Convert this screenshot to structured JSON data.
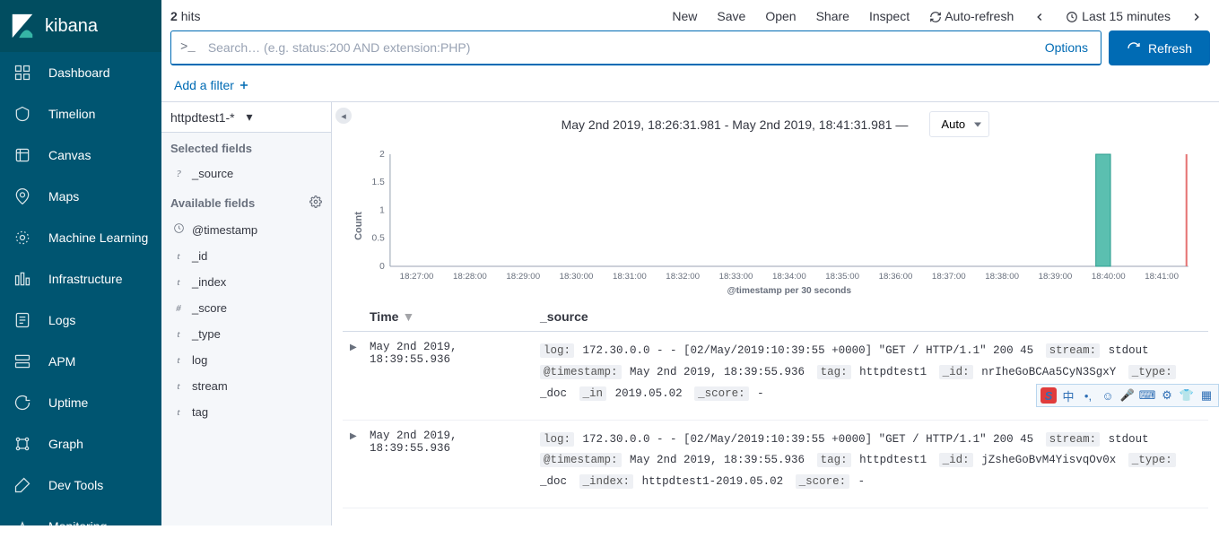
{
  "brand": "kibana",
  "nav": [
    {
      "label": "Dashboard"
    },
    {
      "label": "Timelion"
    },
    {
      "label": "Canvas"
    },
    {
      "label": "Maps"
    },
    {
      "label": "Machine Learning"
    },
    {
      "label": "Infrastructure"
    },
    {
      "label": "Logs"
    },
    {
      "label": "APM"
    },
    {
      "label": "Uptime"
    },
    {
      "label": "Graph"
    },
    {
      "label": "Dev Tools"
    },
    {
      "label": "Monitoring"
    }
  ],
  "hits_count": "2",
  "hits_label": "hits",
  "topmenu": {
    "new": "New",
    "save": "Save",
    "open": "Open",
    "share": "Share",
    "inspect": "Inspect",
    "autorefresh": "Auto-refresh",
    "timerange": "Last 15 minutes"
  },
  "search": {
    "prompt": ">_",
    "placeholder": "Search… (e.g. status:200 AND extension:PHP)",
    "options": "Options",
    "refresh": "Refresh"
  },
  "add_filter": "Add a filter",
  "index_pattern": "httpdtest1-*",
  "fields": {
    "selected_heading": "Selected fields",
    "available_heading": "Available fields",
    "selected": [
      {
        "type": "?",
        "name": "_source"
      }
    ],
    "available": [
      {
        "type": "clock",
        "name": "@timestamp"
      },
      {
        "type": "t",
        "name": "_id"
      },
      {
        "type": "t",
        "name": "_index"
      },
      {
        "type": "#",
        "name": "_score"
      },
      {
        "type": "t",
        "name": "_type"
      },
      {
        "type": "t",
        "name": "log"
      },
      {
        "type": "t",
        "name": "stream"
      },
      {
        "type": "t",
        "name": "tag"
      }
    ]
  },
  "histo": {
    "title": "May 2nd 2019, 18:26:31.981 - May 2nd 2019, 18:41:31.981 —",
    "interval": "Auto",
    "xlabel": "@timestamp per 30 seconds"
  },
  "table": {
    "col_time": "Time",
    "col_source": "_source"
  },
  "rows": [
    {
      "time": "May 2nd 2019, 18:39:55.936",
      "kv": [
        {
          "k": "log:",
          "v": "172.30.0.0 - - [02/May/2019:10:39:55 +0000] \"GET / HTTP/1.1\" 200 45"
        },
        {
          "k": "stream:",
          "v": "stdout"
        },
        {
          "k": "@timestamp:",
          "v": "May 2nd 2019, 18:39:55.936"
        },
        {
          "k": "tag:",
          "v": "httpdtest1"
        },
        {
          "k": "_id:",
          "v": "nrIheGoBCAa5CyN3SgxY"
        },
        {
          "k": "_type:",
          "v": "_doc"
        },
        {
          "k": "_in",
          "v": "2019.05.02"
        },
        {
          "k": "_score:",
          "v": " - "
        }
      ]
    },
    {
      "time": "May 2nd 2019, 18:39:55.936",
      "kv": [
        {
          "k": "log:",
          "v": "172.30.0.0 - - [02/May/2019:10:39:55 +0000] \"GET / HTTP/1.1\" 200 45"
        },
        {
          "k": "stream:",
          "v": "stdout"
        },
        {
          "k": "@timestamp:",
          "v": "May 2nd 2019, 18:39:55.936"
        },
        {
          "k": "tag:",
          "v": "httpdtest1"
        },
        {
          "k": "_id:",
          "v": "jZsheGoBvM4YisvqOv0x"
        },
        {
          "k": "_type:",
          "v": "_doc"
        },
        {
          "k": "_index:",
          "v": "httpdtest1-2019.05.02"
        },
        {
          "k": "_score:",
          "v": " - "
        }
      ]
    }
  ],
  "chart_data": {
    "type": "bar",
    "title": "May 2nd 2019, 18:26:31.981 - May 2nd 2019, 18:41:31.981",
    "xlabel": "@timestamp per 30 seconds",
    "ylabel": "Count",
    "ylim": [
      0,
      2
    ],
    "yticks": [
      0,
      0.5,
      1,
      1.5,
      2
    ],
    "xticks": [
      "18:27:00",
      "18:28:00",
      "18:29:00",
      "18:30:00",
      "18:31:00",
      "18:32:00",
      "18:33:00",
      "18:34:00",
      "18:35:00",
      "18:36:00",
      "18:37:00",
      "18:38:00",
      "18:39:00",
      "18:40:00",
      "18:41:00"
    ],
    "bars": [
      {
        "x": "18:39:55",
        "value": 2
      }
    ]
  }
}
